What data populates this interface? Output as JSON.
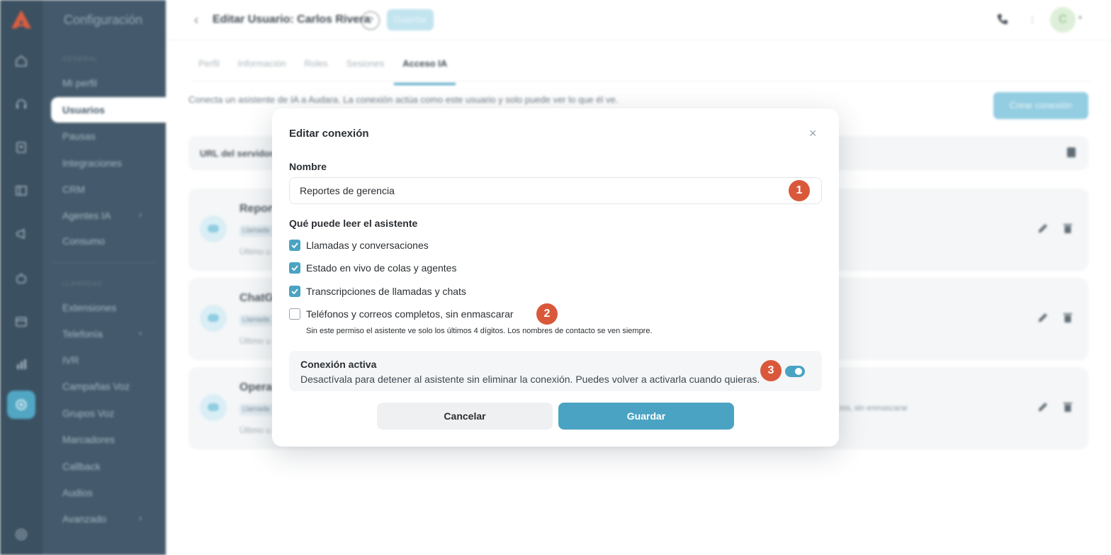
{
  "app": {
    "brand_color": "#d9583a",
    "accent_color": "#4aa3c2",
    "sidebar_title": "Configuración",
    "sections": {
      "general": "GENERAL",
      "llamadas": "LLAMADAS"
    },
    "sidebar_items_general": [
      {
        "label": "Mi perfil"
      },
      {
        "label": "Usuarios",
        "selected": true
      },
      {
        "label": "Pausas"
      },
      {
        "label": "Integraciones"
      },
      {
        "label": "CRM"
      },
      {
        "label": "Agentes IA",
        "has_submenu": true
      },
      {
        "label": "Consumo"
      }
    ],
    "sidebar_items_llamadas": [
      {
        "label": "Extensiones"
      },
      {
        "label": "Telefonía",
        "has_submenu": true
      },
      {
        "label": "IVR"
      },
      {
        "label": "Campañas Voz"
      },
      {
        "label": "Grupos Voz"
      },
      {
        "label": "Marcadores"
      },
      {
        "label": "Callback"
      },
      {
        "label": "Audios"
      },
      {
        "label": "Avanzado",
        "has_submenu": true
      }
    ],
    "rail_icons": [
      "home-icon",
      "headset-icon",
      "contacts-icon",
      "board-icon",
      "megaphone-icon",
      "robot-icon",
      "calendar-icon",
      "chart-icon",
      "settings-icon",
      "help-icon"
    ]
  },
  "header": {
    "title": "Editar Usuario: Carlos Rivera",
    "help": "?",
    "save_label": "Guardar",
    "avatar_initial": "C"
  },
  "tabs": [
    {
      "label": "Perfil"
    },
    {
      "label": "Información"
    },
    {
      "label": "Roles"
    },
    {
      "label": "Sesiones"
    },
    {
      "label": "Acceso IA",
      "active": true
    }
  ],
  "page": {
    "description": "Conecta un asistente de IA a Audara. La conexión actúa como este usuario y solo puede ver lo que él ve.",
    "create_button": "Crear conexión",
    "server_url_label": "URL del servidor",
    "connections": [
      {
        "name": "Report",
        "chip": "Llamada",
        "last": "Último u"
      },
      {
        "name": "ChatG",
        "chip": "Llamada",
        "last": "Último u"
      },
      {
        "name": "Opera",
        "chip": "Llamada",
        "last": "Último u",
        "tail": "...tos, sin enmascarar"
      }
    ]
  },
  "modal": {
    "title": "Editar conexión",
    "close": "×",
    "name_label": "Nombre",
    "name_value": "Reportes de gerencia",
    "permissions_label": "Qué puede leer el asistente",
    "permissions": [
      {
        "label": "Llamadas y conversaciones",
        "checked": true
      },
      {
        "label": "Estado en vivo de colas y agentes",
        "checked": true
      },
      {
        "label": "Transcripciones de llamadas y chats",
        "checked": true
      },
      {
        "label": "Teléfonos y correos completos, sin enmascarar",
        "checked": false
      }
    ],
    "hint": "Sin este permiso el asistente ve solo los últimos 4 dígitos. Los nombres de contacto se ven siempre.",
    "active_title": "Conexión activa",
    "active_desc": "Desactívala para detener al asistente sin eliminar la conexión. Puedes volver a activarla cuando quieras.",
    "active_on": true,
    "cancel_label": "Cancelar",
    "save_label": "Guardar"
  },
  "markers": [
    "1",
    "2",
    "3"
  ]
}
